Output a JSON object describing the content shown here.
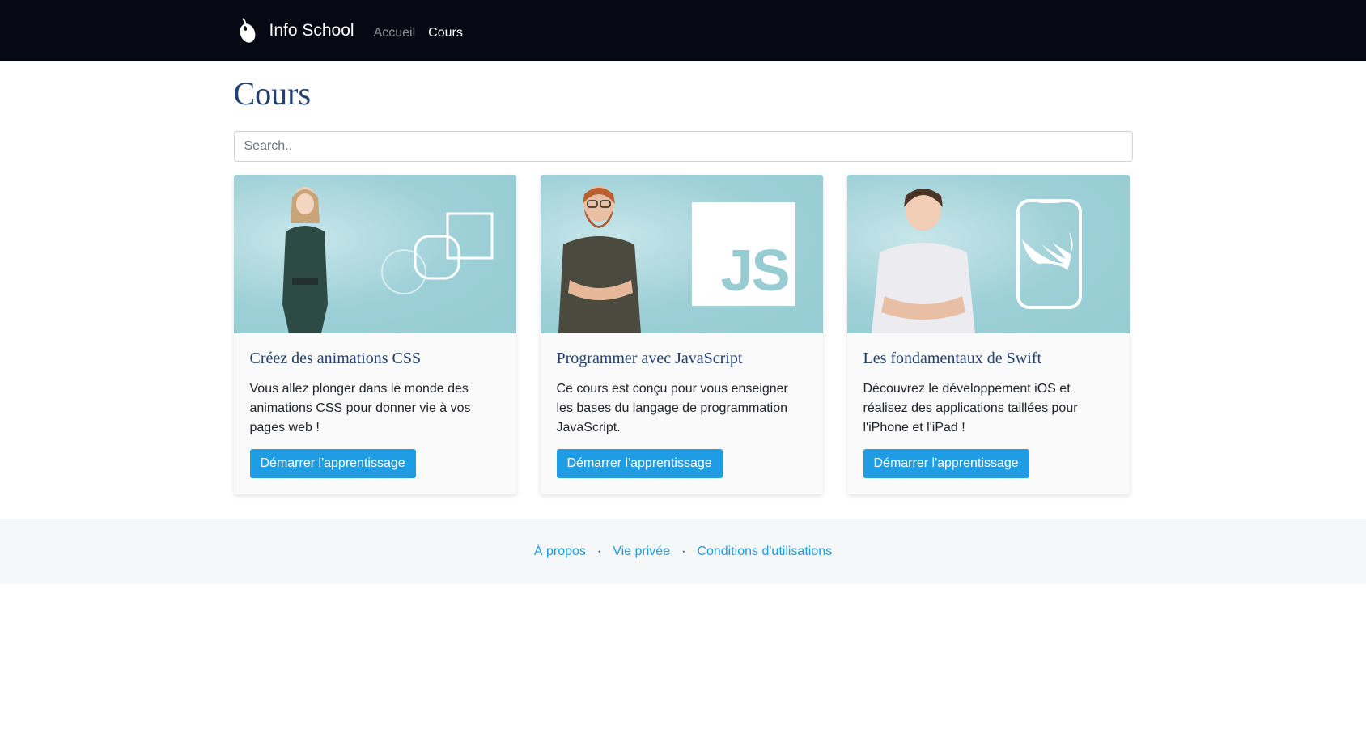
{
  "nav": {
    "brand": "Info School",
    "links": [
      "Accueil",
      "Cours"
    ]
  },
  "page": {
    "title": "Cours",
    "search_placeholder": "Search.."
  },
  "cards": [
    {
      "title": "Créez des animations CSS",
      "text": "Vous allez plonger dans le monde des animations CSS pour donner vie à vos pages web !",
      "button": "Démarrer l'apprentissage"
    },
    {
      "title": "Programmer avec JavaScript",
      "text": "Ce cours est conçu pour vous enseigner les bases du langage de programmation JavaScript.",
      "button": "Démarrer l'apprentissage",
      "badge": "JS"
    },
    {
      "title": "Les fondamentaux de Swift",
      "text": "Découvrez le développement iOS et réalisez des applications taillées pour l'iPhone et l'iPad !",
      "button": "Démarrer l'apprentissage"
    }
  ],
  "footer": {
    "links": [
      "À propos",
      "Vie privée",
      "Conditions d'utilisations"
    ],
    "separator": "·"
  },
  "colors": {
    "navbar": "#060813",
    "title": "#21406f",
    "accent": "#1f9de4",
    "card_image_bg": "#9ccfd6"
  },
  "icons": {
    "brand": "computer-mouse-icon"
  }
}
